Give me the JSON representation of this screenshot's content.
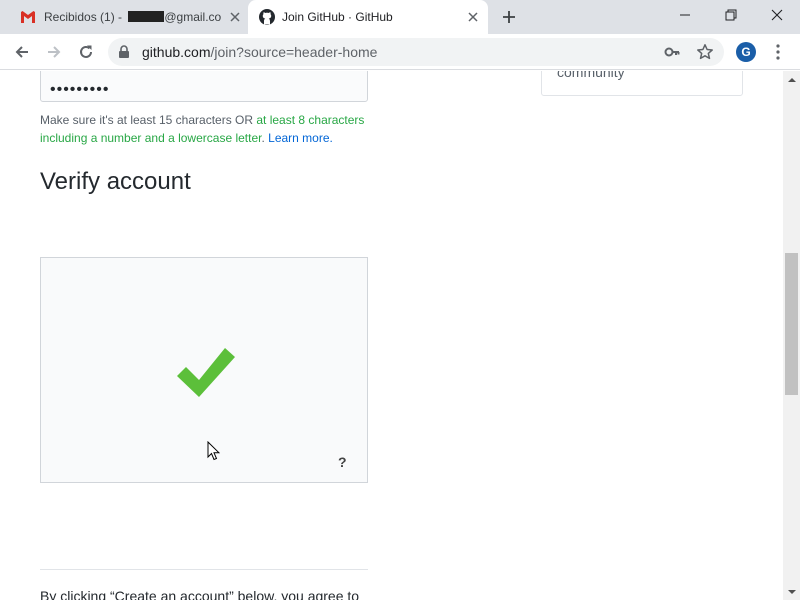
{
  "browser": {
    "tabs": [
      {
        "title": "Recibidos (1) - ",
        "title_suffix": "@gmail.co",
        "favicon": "gmail-icon",
        "active": false
      },
      {
        "title": "Join GitHub · GitHub",
        "favicon": "github-icon",
        "active": true
      }
    ],
    "url_host": "github.com",
    "url_path": "/join?source=header-home",
    "profile_initial": "G"
  },
  "page": {
    "password_value": "•••••••••",
    "hint": {
      "part1": "Make sure it's at least 15 characters OR ",
      "part2": "at least 8 characters including a number and a lowercase letter",
      "part3": ". ",
      "link": "Learn more."
    },
    "verify_title": "Verify account",
    "captcha_help": "?",
    "side_box_text": "community",
    "terms_text": "By clicking “Create an account” below, you agree to"
  },
  "colors": {
    "check": "#5cbf3a",
    "success_text": "#28a745",
    "link": "#0366d6",
    "avatar_bg": "#1a5ea8"
  }
}
